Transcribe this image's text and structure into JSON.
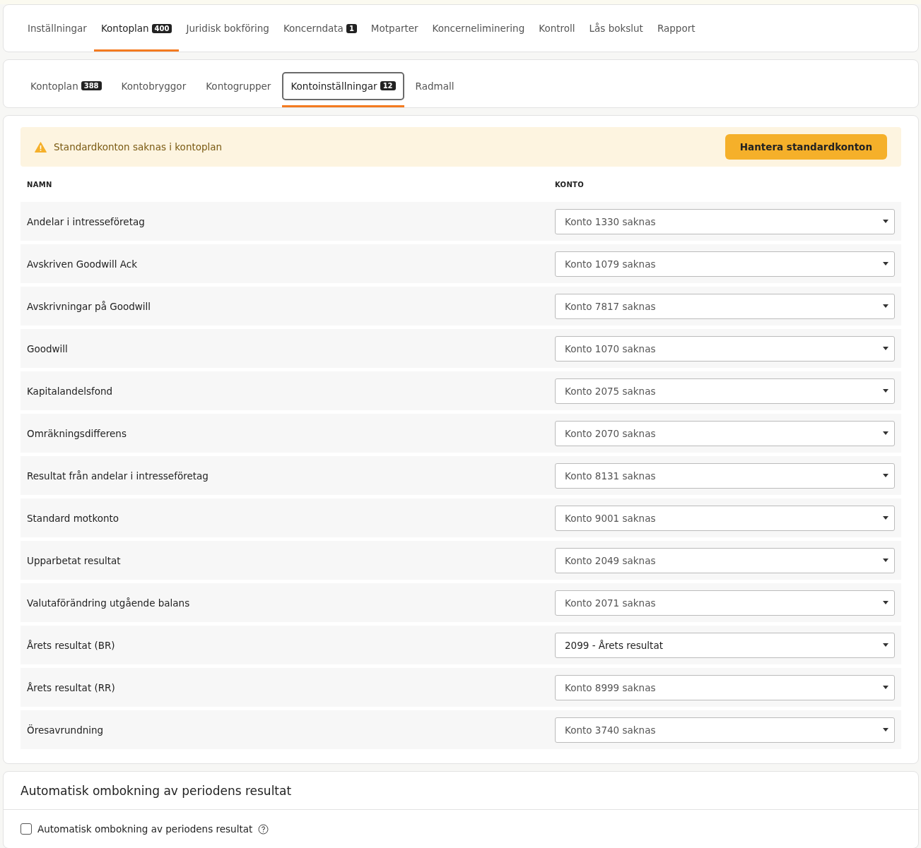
{
  "main_tabs": [
    {
      "label": "Inställningar",
      "selected": false
    },
    {
      "label": "Kontoplan",
      "count": "400",
      "selected": true
    },
    {
      "label": "Juridisk bokföring",
      "selected": false
    },
    {
      "label": "Koncerndata",
      "count": "1",
      "selected": false
    },
    {
      "label": "Motparter",
      "selected": false
    },
    {
      "label": "Koncerneliminering",
      "selected": false
    },
    {
      "label": "Kontroll",
      "selected": false
    },
    {
      "label": "Lås bokslut",
      "selected": false
    },
    {
      "label": "Rapport",
      "selected": false
    }
  ],
  "sub_tabs": [
    {
      "label": "Kontoplan",
      "count": "388",
      "selected": false
    },
    {
      "label": "Kontobryggor",
      "selected": false
    },
    {
      "label": "Kontogrupper",
      "selected": false
    },
    {
      "label": "Kontoinställningar",
      "count": "12",
      "selected": true
    },
    {
      "label": "Radmall",
      "selected": false
    }
  ],
  "alert": {
    "message": "Standardkonton saknas i kontoplan",
    "button": "Hantera standardkonton"
  },
  "table": {
    "columns": [
      "NAMN",
      "KONTO"
    ],
    "rows": [
      {
        "name": "Andelar i intresseföretag",
        "account": {
          "placeholder": "Konto 1330 saknas"
        }
      },
      {
        "name": "Avskriven Goodwill Ack",
        "account": {
          "placeholder": "Konto 1079 saknas"
        }
      },
      {
        "name": "Avskrivningar på Goodwill",
        "account": {
          "placeholder": "Konto 7817 saknas"
        }
      },
      {
        "name": "Goodwill",
        "account": {
          "placeholder": "Konto 1070 saknas"
        }
      },
      {
        "name": "Kapitalandelsfond",
        "account": {
          "placeholder": "Konto 2075 saknas"
        }
      },
      {
        "name": "Omräkningsdifferens",
        "account": {
          "placeholder": "Konto 2070 saknas"
        }
      },
      {
        "name": "Resultat från andelar i intresseföretag",
        "account": {
          "placeholder": "Konto 8131 saknas"
        }
      },
      {
        "name": "Standard motkonto",
        "account": {
          "placeholder": "Konto 9001 saknas"
        }
      },
      {
        "name": "Upparbetat resultat",
        "account": {
          "placeholder": "Konto 2049 saknas"
        }
      },
      {
        "name": "Valutaförändring utgående balans",
        "account": {
          "placeholder": "Konto 2071 saknas"
        }
      },
      {
        "name": "Årets resultat (BR)",
        "account": {
          "value": "2099 - Årets resultat"
        }
      },
      {
        "name": "Årets resultat (RR)",
        "account": {
          "placeholder": "Konto 8999 saknas"
        }
      },
      {
        "name": "Öresavrundning",
        "account": {
          "placeholder": "Konto 3740 saknas"
        }
      }
    ]
  },
  "auto_section": {
    "title": "Automatisk ombokning av periodens resultat",
    "checkbox": {
      "label": "Automatisk ombokning av periodens resultat",
      "checked": false
    }
  }
}
